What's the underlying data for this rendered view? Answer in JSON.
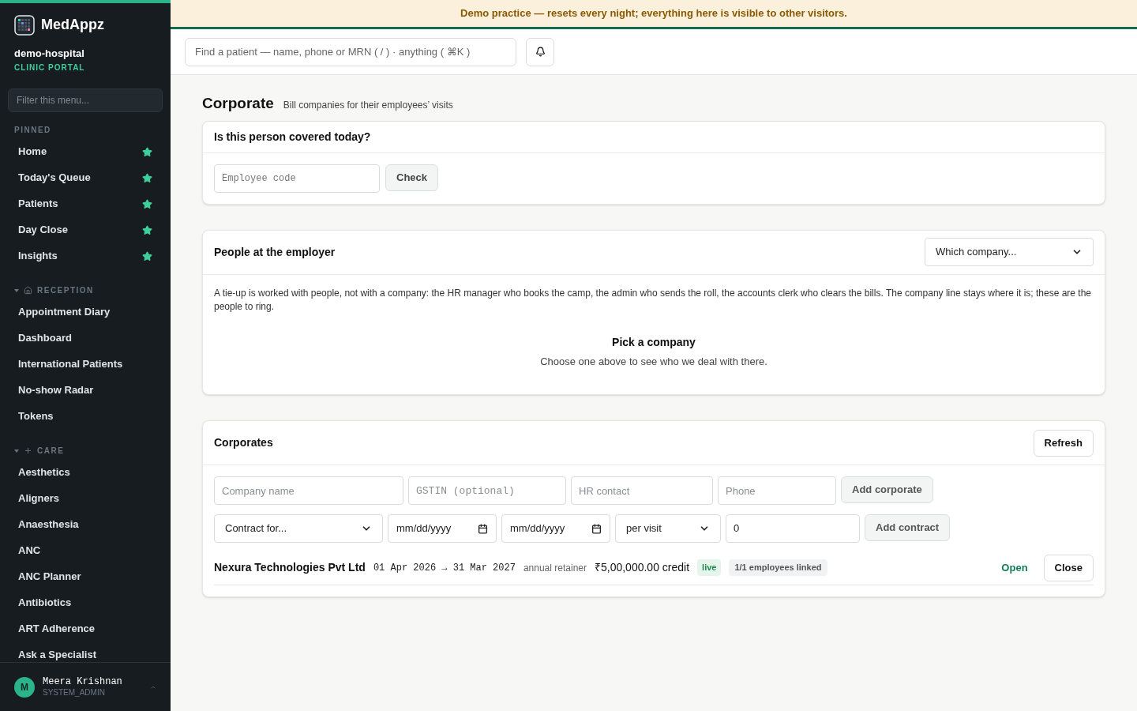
{
  "banner": "Demo practice — resets every night; everything here is visible to other visitors.",
  "sidebar": {
    "brand": "MedAppz",
    "org": "demo-hospital",
    "portal": "CLINIC PORTAL",
    "filter_placeholder": "Filter this menu...",
    "sections": [
      {
        "title": "PINNED",
        "kind": "pinned",
        "items": [
          {
            "label": "Home",
            "pinned": true
          },
          {
            "label": "Today's Queue",
            "pinned": true
          },
          {
            "label": "Patients",
            "pinned": true
          },
          {
            "label": "Day Close",
            "pinned": true
          },
          {
            "label": "Insights",
            "pinned": true
          }
        ]
      },
      {
        "title": "RECEPTION",
        "kind": "reception",
        "expanded": true,
        "items": [
          {
            "label": "Appointment Diary",
            "pinned": false
          },
          {
            "label": "Dashboard",
            "pinned": false
          },
          {
            "label": "International Patients",
            "pinned": false
          },
          {
            "label": "No-show Radar",
            "pinned": false
          },
          {
            "label": "Tokens",
            "pinned": false
          }
        ]
      },
      {
        "title": "CARE",
        "kind": "care",
        "expanded": true,
        "items": [
          {
            "label": "Aesthetics",
            "pinned": false
          },
          {
            "label": "Aligners",
            "pinned": false
          },
          {
            "label": "Anaesthesia",
            "pinned": false
          },
          {
            "label": "ANC",
            "pinned": false
          },
          {
            "label": "ANC Planner",
            "pinned": false
          },
          {
            "label": "Antibiotics",
            "pinned": false
          },
          {
            "label": "ART Adherence",
            "pinned": false
          },
          {
            "label": "Ask a Specialist",
            "pinned": false
          }
        ]
      }
    ],
    "user": {
      "initial": "M",
      "name": "Meera Krishnan",
      "role": "SYSTEM_ADMIN"
    }
  },
  "search": {
    "placeholder": "Find a patient — name, phone or MRN ( / ) · anything ( ⌘K )"
  },
  "page": {
    "title": "Corporate",
    "subtitle": "Bill companies for their employees’ visits"
  },
  "coverage": {
    "title": "Is this person covered today?",
    "placeholder": "Employee code",
    "button": "Check"
  },
  "people": {
    "title": "People at the employer",
    "select": "Which company...",
    "note": "A tie-up is worked with people, not with a company: the HR manager who books the camp, the admin who sends the roll, the accounts clerk who clears the bills. The company line stays where it is; these are the people to ring.",
    "empty_title": "Pick a company",
    "empty_text": "Choose one above to see who we deal with there."
  },
  "corporates": {
    "title": "Corporates",
    "refresh": "Refresh",
    "form1": [
      {
        "kind": "text",
        "placeholder": "Company name"
      },
      {
        "kind": "mono",
        "placeholder": "GSTIN (optional)"
      },
      {
        "kind": "text",
        "placeholder": "HR contact"
      },
      {
        "kind": "text",
        "placeholder": "Phone"
      }
    ],
    "add_corporate": "Add corporate",
    "form2": [
      {
        "kind": "select",
        "value": "Contract for..."
      },
      {
        "kind": "date",
        "value": "mm/dd/yyyy"
      },
      {
        "kind": "date",
        "value": "mm/dd/yyyy"
      },
      {
        "kind": "select",
        "value": "per visit"
      },
      {
        "kind": "number",
        "value": "0"
      }
    ],
    "add_contract": "Add contract",
    "rows": [
      {
        "name": "Nexura Technologies Pvt Ltd",
        "period": "01 Apr 2026 → 31 Mar 2027",
        "type": "annual retainer",
        "credit": "₹5,00,000.00 credit",
        "status": "live",
        "linked": "1/1 employees linked",
        "open": "Open",
        "close": "Close"
      }
    ]
  }
}
